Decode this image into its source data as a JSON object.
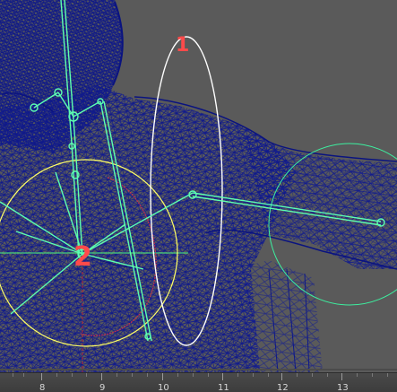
{
  "viewport": {
    "background_color": "#5a5a5a",
    "mesh_color": "#101a8c",
    "joint_color": "#5dffb0",
    "rotate_manipulator_color": "#ffff66",
    "ik_circle_color": "#c8324a",
    "control_circle_color": "#ffffff",
    "wrist_circle_color": "#3df0a0"
  },
  "annotations": {
    "label_1": "1",
    "label_2": "2"
  },
  "timeline": {
    "ticks": [
      "8",
      "9",
      "10",
      "11",
      "12",
      "13"
    ]
  }
}
